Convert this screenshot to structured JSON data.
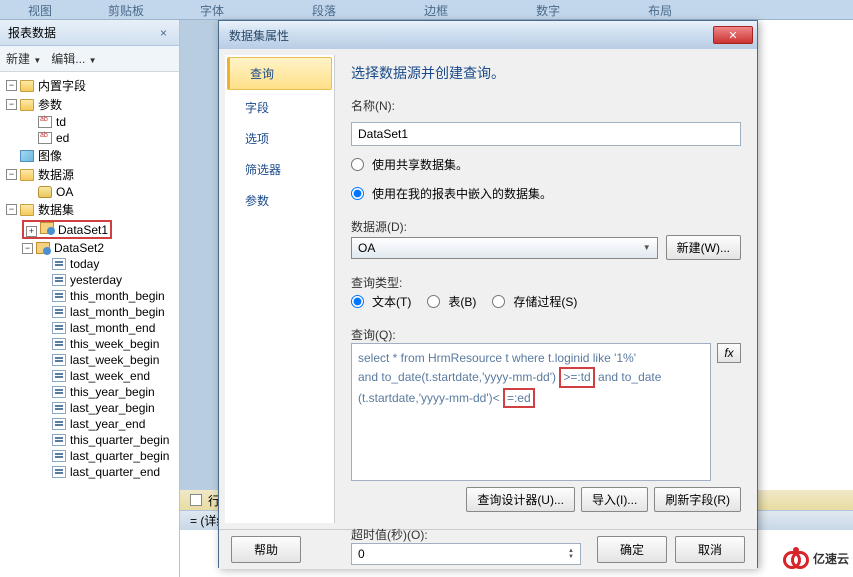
{
  "ribbon": [
    "视图",
    "剪贴板",
    "字体",
    "段落",
    "边框",
    "数字",
    "布局"
  ],
  "panel": {
    "title": "报表数据",
    "new": "新建",
    "edit": "编辑..."
  },
  "tree": {
    "builtin": "内置字段",
    "params": "参数",
    "td": "td",
    "ed": "ed",
    "image": "图像",
    "datasource": "数据源",
    "oa": "OA",
    "datasets": "数据集",
    "ds1": "DataSet1",
    "ds2": "DataSet2",
    "fields": [
      "today",
      "yesterday",
      "this_month_begin",
      "last_month_begin",
      "last_month_end",
      "this_week_begin",
      "last_week_begin",
      "last_week_end",
      "this_year_begin",
      "last_year_begin",
      "last_year_end",
      "this_quarter_begin",
      "last_quarter_begin",
      "last_quarter_end"
    ]
  },
  "rowbar": "行组",
  "detailbar": "= (详细信",
  "dialog": {
    "title": "数据集属性",
    "nav": [
      "查询",
      "字段",
      "选项",
      "筛选器",
      "参数"
    ],
    "heading": "选择数据源并创建查询。",
    "name_label": "名称(N):",
    "name_value": "DataSet1",
    "use_shared": "使用共享数据集。",
    "use_embedded": "使用在我的报表中嵌入的数据集。",
    "ds_label": "数据源(D):",
    "ds_value": "OA",
    "new_btn": "新建(W)...",
    "qt_label": "查询类型:",
    "qt_text": "文本(T)",
    "qt_table": "表(B)",
    "qt_sp": "存储过程(S)",
    "query_label": "查询(Q):",
    "query_line1": "select * from HrmResource t  where t.loginid like '1%'",
    "query_line2a": "and to_date(t.startdate,'yyyy-mm-dd')",
    "query_box1": ">=:td",
    "query_line2b": "and to_date",
    "query_line3a": "(t.startdate,'yyyy-mm-dd')<",
    "query_box2": "=:ed",
    "designer_btn": "查询设计器(U)...",
    "import_btn": "导入(I)...",
    "refresh_btn": "刷新字段(R)",
    "timeout_label": "超时值(秒)(O):",
    "timeout_value": "0",
    "help": "帮助",
    "ok": "确定",
    "cancel": "取消"
  },
  "watermark": "亿速云"
}
